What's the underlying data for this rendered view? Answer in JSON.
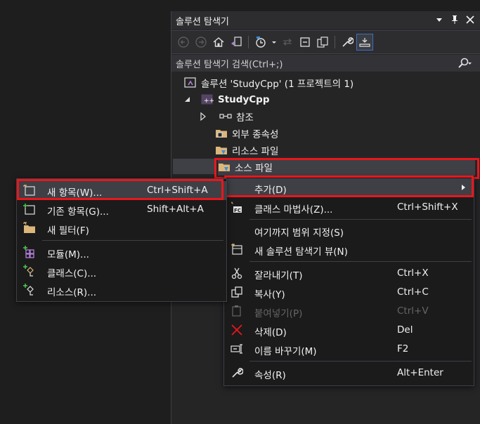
{
  "panel": {
    "title": "솔루션 탐색기",
    "search_placeholder": "솔루션 탐색기 검색(Ctrl+;)"
  },
  "tree": {
    "solution": "솔루션 'StudyCpp' (1 프로젝트의 1)",
    "project": "StudyCpp",
    "references": "참조",
    "external_deps": "외부 종속성",
    "resource_files": "리소스 파일",
    "source_files": "소스 파일"
  },
  "context_menu": {
    "items": [
      {
        "label": "추가(D)",
        "shortcut": ""
      },
      {
        "label": "클래스 마법사(Z)...",
        "shortcut": "Ctrl+Shift+X"
      },
      {
        "label": "여기까지 범위 지정(S)",
        "shortcut": ""
      },
      {
        "label": "새 솔루션 탐색기 뷰(N)",
        "shortcut": ""
      },
      {
        "label": "잘라내기(T)",
        "shortcut": "Ctrl+X"
      },
      {
        "label": "복사(Y)",
        "shortcut": "Ctrl+C"
      },
      {
        "label": "붙여넣기(P)",
        "shortcut": "Ctrl+V"
      },
      {
        "label": "삭제(D)",
        "shortcut": "Del"
      },
      {
        "label": "이름 바꾸기(M)",
        "shortcut": "F2"
      },
      {
        "label": "속성(R)",
        "shortcut": "Alt+Enter"
      }
    ]
  },
  "submenu": {
    "items": [
      {
        "label": "새 항목(W)...",
        "shortcut": "Ctrl+Shift+A"
      },
      {
        "label": "기존 항목(G)...",
        "shortcut": "Shift+Alt+A"
      },
      {
        "label": "새 필터(F)",
        "shortcut": ""
      },
      {
        "label": "모듈(M)...",
        "shortcut": ""
      },
      {
        "label": "클래스(C)...",
        "shortcut": ""
      },
      {
        "label": "리소스(R)...",
        "shortcut": ""
      }
    ]
  },
  "colors": {
    "highlight_border": "#e8171c",
    "accent_purple": "#b180d7",
    "folder_yellow": "#dcb67a"
  }
}
